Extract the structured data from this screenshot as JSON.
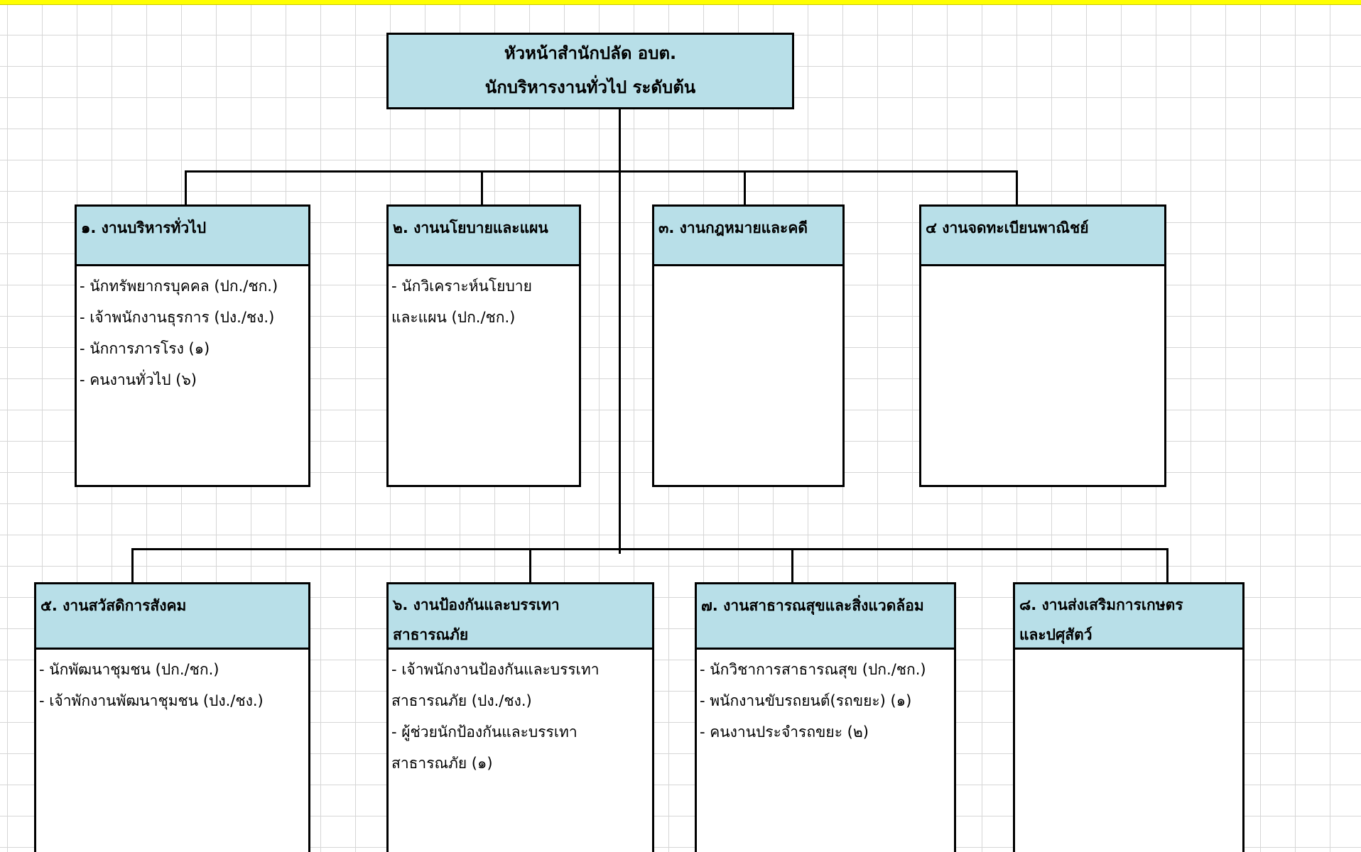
{
  "header": {
    "line1": "หัวหน้าสำนักปลัด อบต.",
    "line2": "นักบริหารงานทั่วไป  ระดับต้น"
  },
  "units": [
    {
      "title_lines": [
        "๑.  งานบริหารทั่วไป"
      ],
      "items": [
        "-  นักทรัพยากรบุคคล  (ปก./ชก.)",
        "-  เจ้าพนักงานธุรการ (ปง./ชง.)",
        "-  นักการภารโรง  (๑)",
        "-  คนงานทั่วไป  (๖)"
      ]
    },
    {
      "title_lines": [
        "๒.  งานนโยบายและแผน"
      ],
      "items": [
        "-  นักวิเคราะห์นโยบาย",
        "และแผน  (ปก./ชก.)"
      ]
    },
    {
      "title_lines": [
        "๓.  งานกฎหมายและคดี"
      ],
      "items": []
    },
    {
      "title_lines": [
        "๔  งานจดทะเบียนพาณิชย์"
      ],
      "items": []
    },
    {
      "title_lines": [
        "๕.  งานสวัสดิการสังคม"
      ],
      "items": [
        "-  นักพัฒนาชุมชน (ปก./ชก.)",
        "-  เจ้าพักงานพัฒนาชุมชน (ปง./ชง.)"
      ]
    },
    {
      "title_lines": [
        "๖.  งานป้องกันและบรรเทา",
        "สาธารณภัย"
      ],
      "items": [
        "-  เจ้าพนักงานป้องกันและบรรเทา",
        "สาธารณภัย (ปง./ชง.)",
        "-  ผู้ช่วยนักป้องกันและบรรเทา",
        "สาธารณภัย (๑)"
      ]
    },
    {
      "title_lines": [
        "๗.  งานสาธารณสุขและสิ่งแวดล้อม"
      ],
      "items": [
        "-  นักวิชาการสาธารณสุข (ปก./ชก.)",
        "-  พนักงานขับรถยนต์(รถขยะ)  (๑)",
        "-  คนงานประจำรถขยะ  (๒)"
      ]
    },
    {
      "title_lines": [
        "๘.  งานส่งเสริมการเกษตร",
        "และปศุสัตว์"
      ],
      "items": []
    }
  ]
}
